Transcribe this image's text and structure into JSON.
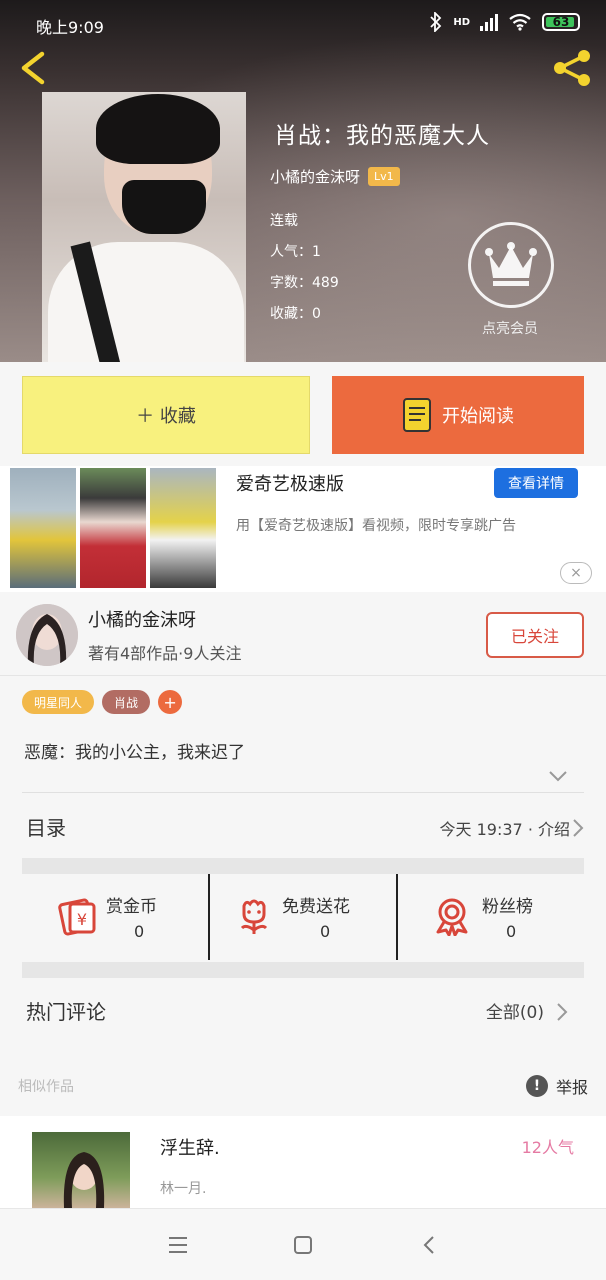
{
  "status_bar": {
    "time": "晚上9:09",
    "network": "HD",
    "battery": "63"
  },
  "book": {
    "title": "肖战：我的恶魔大人",
    "author": "小橘的金沫呀",
    "level": "Lv1",
    "status": "连载",
    "popularity": "人气：1",
    "word_count": "字数：489",
    "favorites": "收藏：0",
    "vip_label": "点亮会员"
  },
  "actions": {
    "collect": "＋ 收藏",
    "read": "开始阅读"
  },
  "ad": {
    "title": "爱奇艺极速版",
    "description": "用【爱奇艺极速版】看视频，限时专享跳广告",
    "detail_button": "查看详情",
    "close": "×"
  },
  "author_block": {
    "name": "小橘的金沫呀",
    "stats": "著有4部作品·9人关注",
    "follow_button": "已关注"
  },
  "tags": [
    {
      "label": "明星同人",
      "color": "#f2b84a"
    },
    {
      "label": "肖战",
      "color": "#b26c63"
    }
  ],
  "tag_add": "+",
  "summary": "恶魔：我的小公主，我来迟了",
  "toc": {
    "label": "目录",
    "info": "今天 19:37 · 介绍"
  },
  "stats": [
    {
      "title": "赏金币",
      "value": "0"
    },
    {
      "title": "免费送花",
      "value": "0"
    },
    {
      "title": "粉丝榜",
      "value": "0"
    }
  ],
  "hot_comments": {
    "label": "热门评论",
    "all": "全部(0)"
  },
  "similar": {
    "label": "相似作品",
    "report": "举报",
    "report_icon": "!",
    "item": {
      "title": "浮生辞.",
      "subtitle": "林一月.",
      "popularity": "12人气"
    }
  },
  "icons": {
    "back": "chevron-left-icon",
    "share": "share-icon",
    "crown": "crown-icon",
    "book": "book-icon",
    "money": "red-envelope-icon",
    "flower": "flower-icon",
    "medal": "medal-icon"
  },
  "colors": {
    "accent_orange": "#ec6a3e",
    "collect_yellow": "#f8f17e",
    "ad_blue": "#1d6fe0",
    "follow_red": "#d85a47",
    "icon_red": "#d8463a",
    "popularity_pink": "#e57aa3"
  }
}
